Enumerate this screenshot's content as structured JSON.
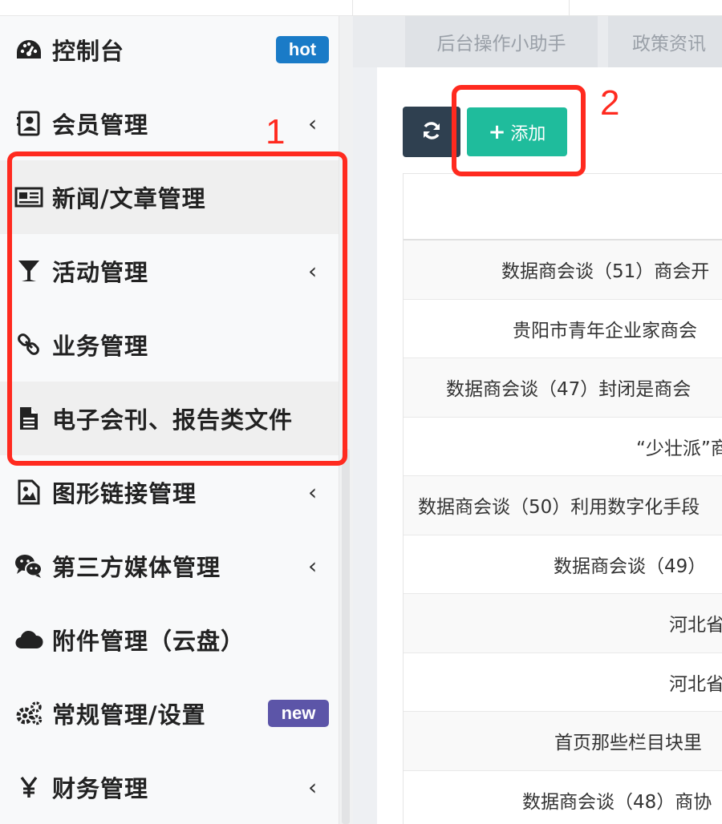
{
  "sidebar": {
    "items": [
      {
        "label": "控制台",
        "icon": "dashboard-icon",
        "badge": "hot"
      },
      {
        "label": "会员管理",
        "icon": "contact-card-icon",
        "chevron": "‹"
      },
      {
        "label": "新闻/文章管理",
        "icon": "newspaper-icon"
      },
      {
        "label": "活动管理",
        "icon": "cocktail-glass-icon",
        "chevron": "‹"
      },
      {
        "label": "业务管理",
        "icon": "link-icon"
      },
      {
        "label": "电子会刊、报告类文件",
        "icon": "file-text-icon"
      },
      {
        "label": "图形链接管理",
        "icon": "image-icon",
        "chevron": "‹"
      },
      {
        "label": "第三方媒体管理",
        "icon": "wechat-icon",
        "chevron": "‹"
      },
      {
        "label": "附件管理（云盘）",
        "icon": "cloud-icon"
      },
      {
        "label": "常规管理/设置",
        "icon": "gears-icon",
        "badge": "new"
      },
      {
        "label": "财务管理",
        "icon": "yen-icon",
        "chevron": "‹"
      }
    ]
  },
  "tabs": [
    {
      "label": "后台操作小助手"
    },
    {
      "label": "政策资讯"
    }
  ],
  "toolbar": {
    "refresh_icon": "refresh-icon",
    "add_label": "添加",
    "add_icon": "+"
  },
  "table": {
    "header": "",
    "rows": [
      "数据商会谈（51）商会开",
      "贵阳市青年企业家商会",
      "数据商会谈（47）封闭是商会",
      "“少壮派”商",
      "数据商会谈（50）利用数字化手段",
      "数据商会谈（49）",
      "河北省",
      "河北省",
      "首页那些栏目块里",
      "数据商会谈（48）商协"
    ]
  },
  "annotations": {
    "box1_number": "1",
    "box2_number": "2",
    "color": "#ff2a1f"
  },
  "colors": {
    "add_button": "#1fbc9c",
    "refresh_button": "#2f4050",
    "hot_badge": "#1a7bc7",
    "new_badge": "#5c55a8"
  }
}
